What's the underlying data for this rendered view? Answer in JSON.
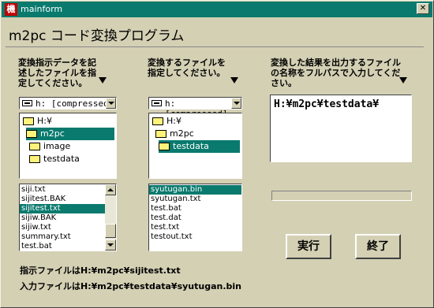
{
  "window": {
    "title": "mainform",
    "app_icon": "機",
    "close_glyph": "✕"
  },
  "header": {
    "app_title": "m2pc コード変換プログラム"
  },
  "col1": {
    "instruction": "変換指示データを記述したファイルを指定してください。",
    "drive": "h: [compressed]",
    "dirs": [
      "H:¥",
      "m2pc",
      "image",
      "testdata"
    ],
    "files": [
      "siji.txt",
      "sijitest.BAK",
      "sijitest.txt",
      "sijiw.BAK",
      "sijiw.txt",
      "summary.txt",
      "test.bat"
    ]
  },
  "col2": {
    "instruction": "変換するファイルを指定してください。",
    "drive": "h: [compressed]",
    "dirs": [
      "H:¥",
      "m2pc",
      "testdata"
    ],
    "files": [
      "syutugan.bin",
      "syutugan.txt",
      "test.bat",
      "test.dat",
      "test.txt",
      "testout.txt"
    ]
  },
  "col3": {
    "instruction": "変換した結果を出力するファイルの名称をフルパスで入力してください。",
    "output_path": "H:¥m2pc¥testdata¥"
  },
  "buttons": {
    "run": "実行",
    "exit": "終了"
  },
  "status": {
    "instruction_file": "指示ファイルはH:¥m2pc¥sijitest.txt",
    "input_file": "入力ファイルはH:¥m2pc¥testdata¥syutugan.bin"
  },
  "colors": {
    "selection": "#0a7a6e",
    "face": "#d4d0b4"
  }
}
